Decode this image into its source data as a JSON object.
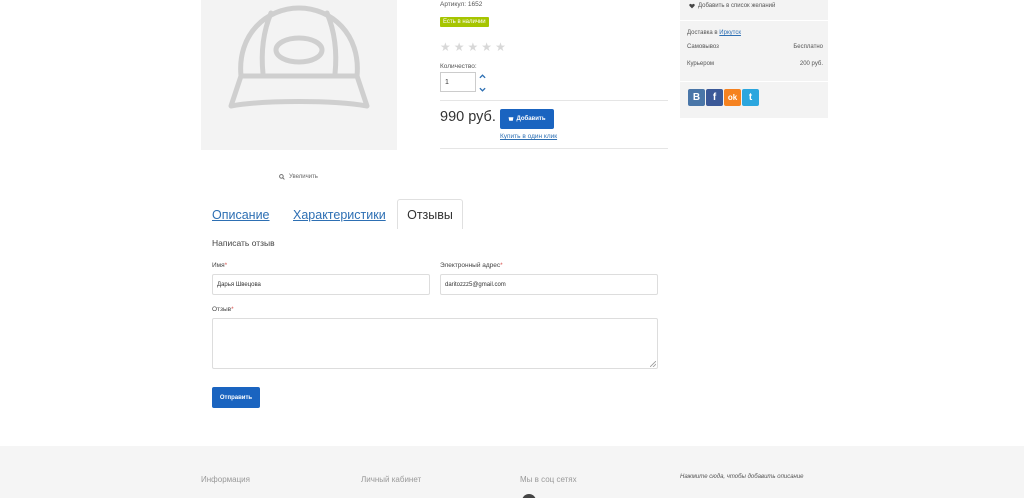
{
  "product": {
    "sku": "Артикул: 1652",
    "stock": "Есть в наличии",
    "rating": 0,
    "rating_max": 5,
    "qty_label": "Количество:",
    "qty": "1",
    "price": "990 руб.",
    "add_label": "Добавить",
    "one_click": "Купить в один клик",
    "zoom": "Увеличить"
  },
  "side": {
    "wishlist": "Добавить в список желаний",
    "delivery_label": "Доставка в",
    "city": "Иркутск",
    "rows": [
      {
        "name": "Самовывоз",
        "value": "Бесплатно"
      },
      {
        "name": "Курьером",
        "value": "200 руб."
      }
    ],
    "socials": [
      {
        "name": "vk-icon",
        "glyph": "В",
        "color": "#4a76a8"
      },
      {
        "name": "facebook-icon",
        "glyph": "f",
        "color": "#3b5998"
      },
      {
        "name": "odnoklassniki-icon",
        "glyph": "ok",
        "color": "#f58220"
      },
      {
        "name": "twitter-icon",
        "glyph": "t",
        "color": "#2ba6de"
      }
    ]
  },
  "tabs": {
    "description": "Описание",
    "specs": "Характеристики",
    "reviews": "Отзывы"
  },
  "review_form": {
    "title": "Написать отзыв",
    "name_label": "Имя",
    "name_value": "Дарья Швецова",
    "email_label": "Электронный адрес",
    "email_value": "daritozzz5@gmail.com",
    "review_label": "Отзыв",
    "required_mark": "*",
    "submit": "Отправить"
  },
  "footer": {
    "info": "Информация",
    "account": "Личный кабинет",
    "social": "Мы в соц сетях",
    "desc": "Нажмите сюда, чтобы добавить описание"
  },
  "colors": {
    "accent": "#1a64c0",
    "stock": "#a6c500",
    "required": "#d9534f"
  }
}
